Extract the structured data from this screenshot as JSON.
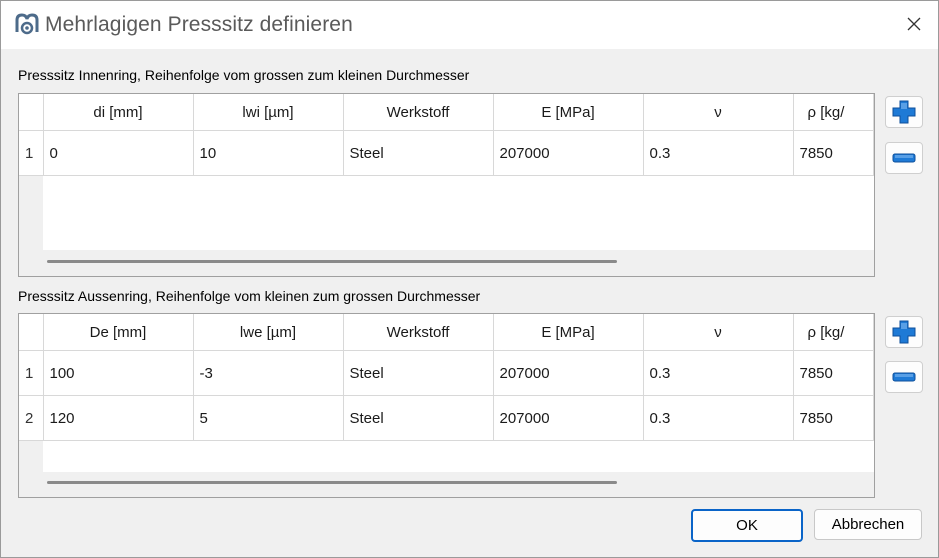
{
  "window": {
    "title": "Mehrlagigen Presssitz definieren"
  },
  "inner": {
    "label": "Presssitz Innenring, Reihenfolge vom grossen zum kleinen Durchmesser",
    "columns": [
      "di [mm]",
      "lwi [µm]",
      "Werkstoff",
      "E [MPa]",
      "ν",
      "ρ [kg/"
    ],
    "rows": [
      {
        "num": "1",
        "cells": [
          "0",
          "10",
          "Steel",
          "207000",
          "0.3",
          "7850"
        ]
      }
    ]
  },
  "outer": {
    "label": "Presssitz Aussenring, Reihenfolge vom kleinen zum grossen Durchmesser",
    "columns": [
      "De [mm]",
      "lwe [µm]",
      "Werkstoff",
      "E [MPa]",
      "ν",
      "ρ [kg/"
    ],
    "rows": [
      {
        "num": "1",
        "cells": [
          "100",
          "-3",
          "Steel",
          "207000",
          "0.3",
          "7850"
        ]
      },
      {
        "num": "2",
        "cells": [
          "120",
          "5",
          "Steel",
          "207000",
          "0.3",
          "7850"
        ]
      }
    ]
  },
  "buttons": {
    "ok": "OK",
    "cancel": "Abbrechen"
  },
  "colors": {
    "accent": "#0a64c8",
    "plus_icon": "#1e7ad6"
  }
}
